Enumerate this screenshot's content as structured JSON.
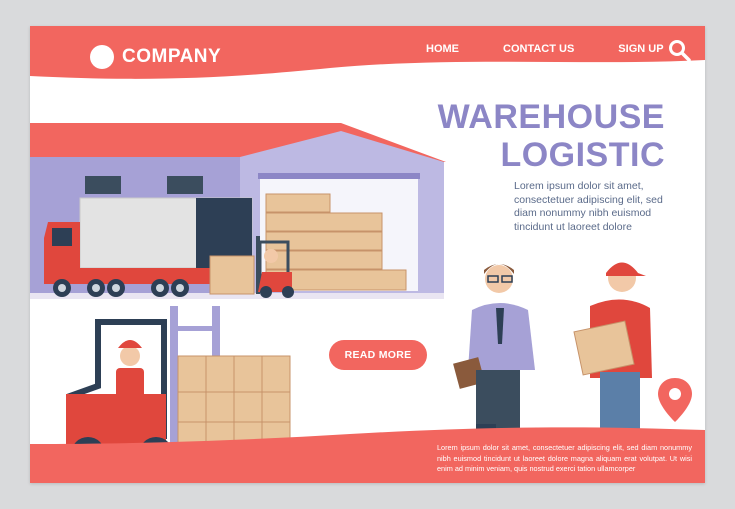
{
  "header": {
    "brand": "COMPANY",
    "nav": [
      "HOME",
      "CONTACT US",
      "SIGN UP"
    ],
    "search_icon": "search-icon"
  },
  "hero": {
    "title_line1": "WAREHOUSE",
    "title_line2": "LOGISTIC",
    "description": "Lorem ipsum dolor sit amet, consectetuer adipiscing elit, sed diam nonummy nibh euismod tincidunt ut laoreet dolore",
    "cta_label": "READ MORE"
  },
  "footer": {
    "text": "Lorem ipsum dolor sit amet, consectetuer adipiscing elit, sed diam nonummy nibh euismod tincidunt ut laoreet dolore magna aliquam erat volutpat. Ut wisi enim ad minim veniam, quis nostrud exerci tation ullamcorper"
  },
  "colors": {
    "accent": "#f2665f",
    "title": "#8c86c6",
    "warehouse_wall": "#a6a1d6",
    "box": "#e8c49a"
  },
  "icons": [
    "search-icon",
    "location-pin-icon"
  ]
}
